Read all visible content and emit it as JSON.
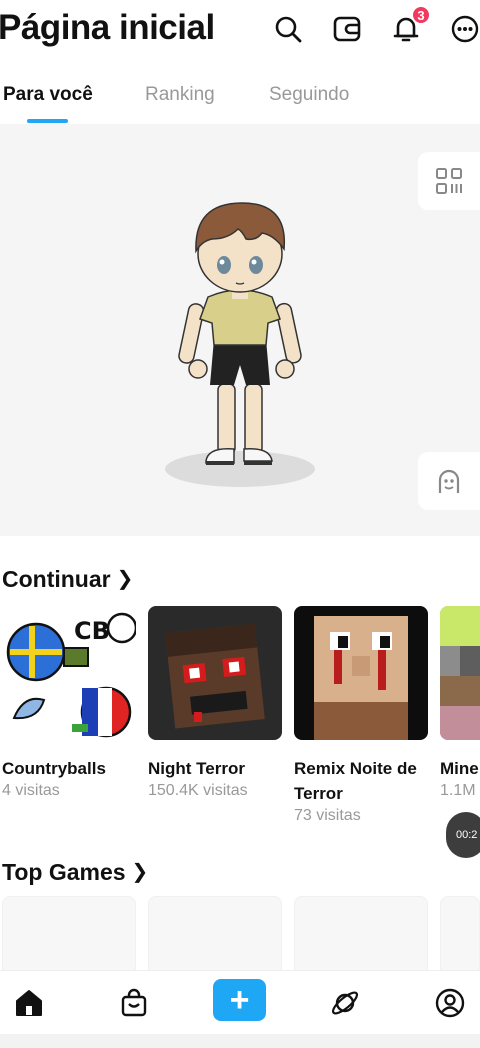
{
  "header": {
    "title": "Página inicial",
    "icons": [
      "search-icon",
      "wallet-icon",
      "bell-icon",
      "more-icon"
    ],
    "notification_count": "3"
  },
  "tabs": [
    {
      "label": "Para você",
      "active": true
    },
    {
      "label": "Ranking",
      "active": false
    },
    {
      "label": "Seguindo",
      "active": false
    }
  ],
  "avatar_panel": {
    "side_buttons": [
      "qr-code-icon",
      "avatar-face-icon"
    ]
  },
  "continue_section": {
    "title": "Continuar",
    "games": [
      {
        "name": "Countryballs",
        "visits": "4 visitas",
        "thumb": "countryballs"
      },
      {
        "name": "Night Terror",
        "visits": "150.4K visitas",
        "thumb": "night-terror"
      },
      {
        "name": "Remix Noite de Terror",
        "visits": "73 visitas",
        "thumb": "remix-noite"
      },
      {
        "name": "Mine Ultim",
        "visits": "1.1M",
        "thumb": "minecraft"
      }
    ]
  },
  "video_overlay": {
    "time": "00:2"
  },
  "top_games_section": {
    "title": "Top Games"
  },
  "bottom_nav": {
    "items": [
      "home-icon",
      "shop-icon",
      "create-icon",
      "discover-icon",
      "profile-icon"
    ],
    "create_symbol": "+"
  },
  "colors": {
    "accent": "#1ea7f5",
    "badge": "#f03a5f",
    "secondary_text": "#999999"
  }
}
